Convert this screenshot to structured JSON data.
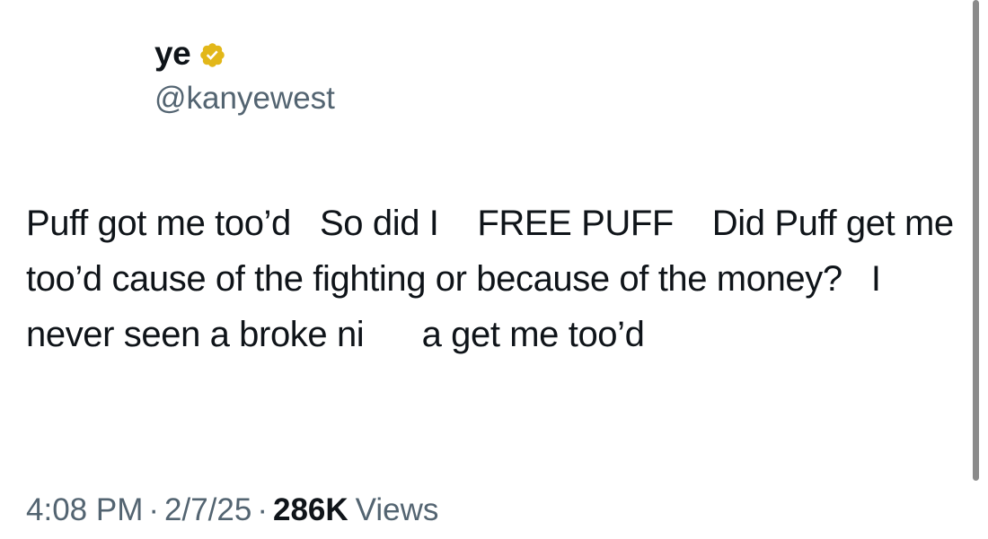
{
  "author": {
    "display_name": "ye",
    "handle": "@kanyewest",
    "verified_badge_icon": "verified-gold-check",
    "badge_color": "#E2B719"
  },
  "tweet": {
    "text": "Puff got me too’d   So did I    FREE PUFF    Did Puff get me too’d cause of the fighting or because of the money?   I never seen a broke ni      a get me too’d"
  },
  "meta": {
    "time": "4:08 PM",
    "separator": "·",
    "date": "2/7/25",
    "views_count": "286K",
    "views_label": "Views"
  },
  "colors": {
    "text_primary": "#0F1419",
    "text_secondary": "#536471",
    "scrollbar": "#8B8B8B"
  }
}
